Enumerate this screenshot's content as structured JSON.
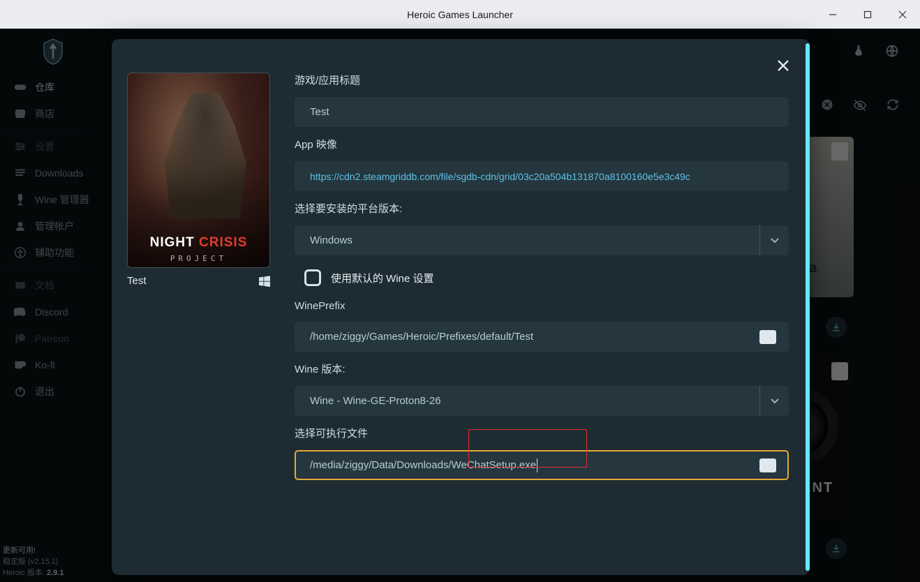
{
  "window": {
    "title": "Heroic Games Launcher"
  },
  "sidebar": {
    "items": [
      {
        "icon": "gamepad",
        "label": "仓库",
        "active": true
      },
      {
        "icon": "store",
        "label": "商店"
      },
      {
        "divider": true
      },
      {
        "icon": "sliders",
        "label": "设置",
        "dim": true
      },
      {
        "icon": "download",
        "label": "Downloads"
      },
      {
        "icon": "wine",
        "label": "Wine 管理器"
      },
      {
        "icon": "user",
        "label": "管理帐户"
      },
      {
        "icon": "accessibility",
        "label": "辅助功能"
      },
      {
        "divider": true
      },
      {
        "icon": "book",
        "label": "文档",
        "dim": true
      },
      {
        "icon": "discord",
        "label": "Discord"
      },
      {
        "icon": "patreon",
        "label": "Patreon",
        "dim": true
      },
      {
        "icon": "kofi",
        "label": "Ko-fi"
      },
      {
        "icon": "power",
        "label": "退出"
      }
    ],
    "footer": {
      "update_available": "更新可用!",
      "stable_label": "稳定版 (v2.15.1)",
      "version_label": "Heroic 版本:",
      "version_value": "2.9.1"
    }
  },
  "main_bg": {
    "card_a_title": "Alba",
    "card_b_title": "LAMENT"
  },
  "modal": {
    "cover_title": "Test",
    "cover_logo_pre": "NIGHT ",
    "cover_logo_accent": "CRISIS",
    "cover_logo_sub": "PROJECT",
    "fields": {
      "title_label": "游戏/应用标题",
      "title_value": "Test",
      "image_label": "App 映像",
      "image_value": "https://cdn2.steamgriddb.com/file/sgdb-cdn/grid/03c20a504b131870a8100160e5e3c49c",
      "platform_label": "选择要安装的平台版本:",
      "platform_value": "Windows",
      "default_wine_label": "使用默认的 Wine 设置",
      "wineprefix_label": "WinePrefix",
      "wineprefix_value": "/home/ziggy/Games/Heroic/Prefixes/default/Test",
      "wine_version_label": "Wine 版本:",
      "wine_version_value": "Wine - Wine-GE-Proton8-26",
      "executable_label": "选择可执行文件",
      "executable_value": "/media/ziggy/Data/Downloads/WeChatSetup.exe"
    }
  }
}
